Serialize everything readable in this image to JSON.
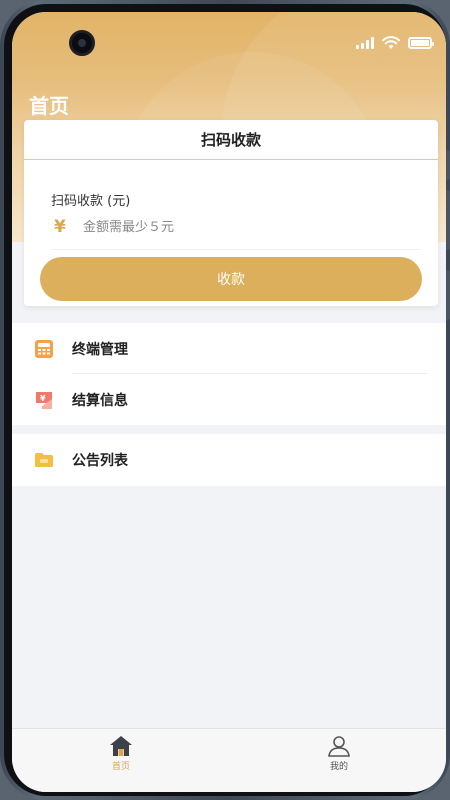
{
  "colors": {
    "accent": "#dcaf5c",
    "header_gold": "#e2b468",
    "tab_active": "#d8a84e",
    "tab_inactive": "#555555",
    "background": "#f2f3f6"
  },
  "header": {
    "title": "首页"
  },
  "collect_card": {
    "title": "扫码收款",
    "amount_label": "扫码收款 (元)",
    "currency_symbol": "¥",
    "amount_value": "",
    "amount_placeholder": "金额需最少５元",
    "submit_label": "收款"
  },
  "menu": [
    {
      "label": "终端管理",
      "icon": "pos-terminal-icon"
    },
    {
      "label": "结算信息",
      "icon": "settlement-yen-icon"
    },
    {
      "label": "公告列表",
      "icon": "announcement-folder-icon"
    }
  ],
  "tabbar": {
    "items": [
      {
        "label": "首页",
        "icon": "home-icon",
        "active": true
      },
      {
        "label": "我的",
        "icon": "user-icon",
        "active": false
      }
    ]
  }
}
